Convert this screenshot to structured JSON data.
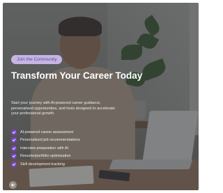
{
  "hero": {
    "badge": "Join the Community",
    "title": "Transform Your Career Today",
    "description": "Start your journey with AI-powered career guidance, personalized opportunities, and tools designed to accelerate your professional growth.",
    "features": [
      {
        "label": "AI-powered career assessment",
        "icon": "check-icon"
      },
      {
        "label": "Personalized job recommendations",
        "icon": "check-icon"
      },
      {
        "label": "Interview preparation with AI",
        "icon": "check-icon"
      },
      {
        "label": "Resume/portfolio optimization",
        "icon": "check-icon"
      },
      {
        "label": "Skill development tracking",
        "icon": "check-icon"
      }
    ]
  },
  "nav": {
    "back_icon": "arrow-left-icon"
  },
  "colors": {
    "accent": "#7a45c8",
    "badge_bg": "#cdbeeb",
    "badge_text": "#6a3fb8",
    "title": "#ffffff"
  }
}
